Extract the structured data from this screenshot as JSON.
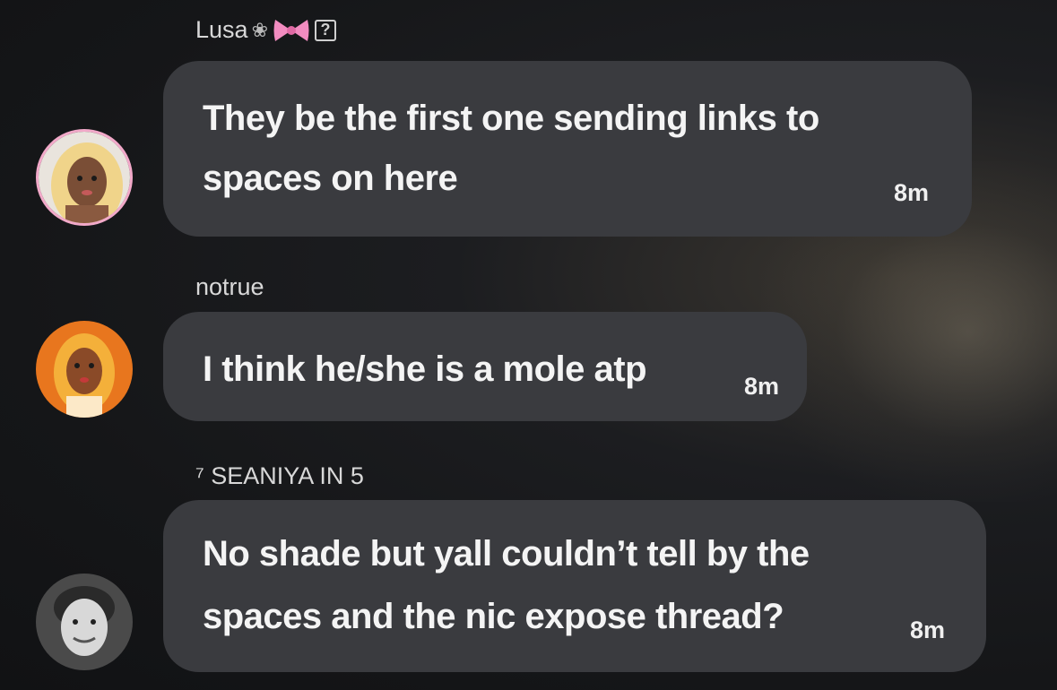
{
  "messages": [
    {
      "sender": "Lusa",
      "sender_icons": [
        "flower-icon",
        "pink-bow-icon",
        "question-box-icon"
      ],
      "text_line1": "They be the first one sending links to",
      "text_line2": "spaces on here",
      "time": "8m"
    },
    {
      "sender": "notrue",
      "text_line1": "I think he/she is a mole atp",
      "time": "8m"
    },
    {
      "sender": "⁷ SEANIYA IN 5",
      "text_line1": "No shade but yall couldn’t tell by the",
      "text_line2": "spaces and the nic expose thread?",
      "time": "8m"
    }
  ],
  "colors": {
    "background": "#151618",
    "bubble": "#3a3b3f",
    "text": "#f4f4f4",
    "sender": "#d8d8d8",
    "bow": "#f28cc0"
  }
}
